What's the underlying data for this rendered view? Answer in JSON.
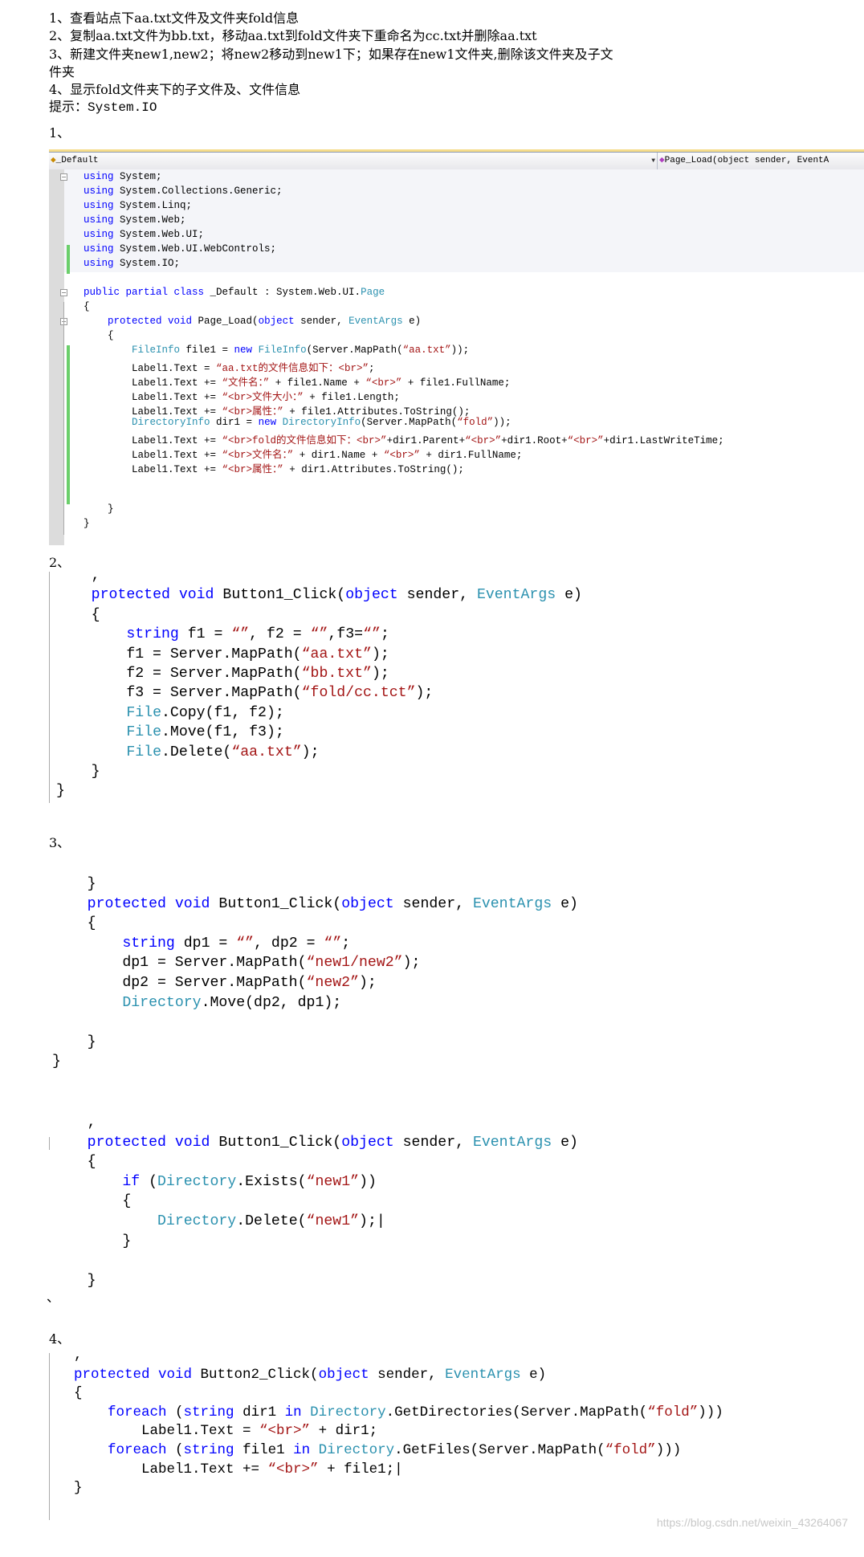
{
  "intro": [
    "1、查看站点下aa.txt文件及文件夹fold信息",
    "2、复制aa.txt文件为bb.txt，移动aa.txt到fold文件夹下重命名为cc.txt并删除aa.txt",
    "3、新建文件夹new1,new2；将new2移动到new1下；如果存在new1文件夹,删除该文件夹及子文",
    "件夹",
    "4、显示fold文件夹下的子文件及、文件信息",
    "提示：System.IO"
  ],
  "section_labels": [
    "1、",
    "2、",
    "3、",
    "、",
    "4、"
  ],
  "editor": {
    "class_dropdown": "_Default",
    "method_dropdown": "Page_Load(object sender, EventA",
    "class_icon": "class-icon",
    "method_icon": "method-icon"
  },
  "colors": {
    "keyword": "#0000ff",
    "type": "#2b91af",
    "string": "#a31515",
    "change_bar": "#6bcf6b"
  },
  "code": {
    "s1": [
      [
        [
          "using",
          "k"
        ],
        [
          " System;",
          "n"
        ]
      ],
      [
        [
          "using",
          "k"
        ],
        [
          " System.Collections.Generic;",
          "n"
        ]
      ],
      [
        [
          "using",
          "k"
        ],
        [
          " System.Linq;",
          "n"
        ]
      ],
      [
        [
          "using",
          "k"
        ],
        [
          " System.Web;",
          "n"
        ]
      ],
      [
        [
          "using",
          "k"
        ],
        [
          " System.Web.UI;",
          "n"
        ]
      ],
      [
        [
          "using",
          "k"
        ],
        [
          " System.Web.UI.WebControls;",
          "n"
        ]
      ],
      [
        [
          "using",
          "k"
        ],
        [
          " System.IO;",
          "n"
        ]
      ],
      [],
      [
        [
          "public partial class",
          "k"
        ],
        [
          " _Default : System.Web.UI.",
          "n"
        ],
        [
          "Page",
          "t"
        ]
      ],
      [
        [
          "{",
          "n"
        ]
      ],
      [
        [
          "    ",
          "n"
        ],
        [
          "protected void",
          "k"
        ],
        [
          " Page_Load(",
          "n"
        ],
        [
          "object",
          "k"
        ],
        [
          " sender, ",
          "n"
        ],
        [
          "EventArgs",
          "t"
        ],
        [
          " e)",
          "n"
        ]
      ],
      [
        [
          "    {",
          "n"
        ]
      ],
      [
        [
          "        ",
          "n"
        ],
        [
          "FileInfo",
          "t"
        ],
        [
          " file1 = ",
          "n"
        ],
        [
          "new",
          "k"
        ],
        [
          " ",
          "n"
        ],
        [
          "FileInfo",
          "t"
        ],
        [
          "(Server.MapPath(",
          "n"
        ],
        [
          "“aa.txt”",
          "s"
        ],
        [
          "));",
          "n"
        ]
      ],
      [
        [
          "        Label1.Text = ",
          "n"
        ],
        [
          "“aa.txt的文件信息如下：<br>”",
          "s"
        ],
        [
          ";",
          "n"
        ]
      ],
      [
        [
          "        Label1.Text += ",
          "n"
        ],
        [
          "“文件名：”",
          "s"
        ],
        [
          " + file1.Name + ",
          "n"
        ],
        [
          "“<br>”",
          "s"
        ],
        [
          " + file1.FullName;",
          "n"
        ]
      ],
      [
        [
          "        Label1.Text += ",
          "n"
        ],
        [
          "“<br>文件大小：”",
          "s"
        ],
        [
          " + file1.Length;",
          "n"
        ]
      ],
      [
        [
          "        Label1.Text += ",
          "n"
        ],
        [
          "“<br>属性：”",
          "s"
        ],
        [
          " + file1.Attributes.ToString();",
          "n"
        ]
      ],
      [
        [
          "        ",
          "n"
        ],
        [
          "DirectoryInfo",
          "t"
        ],
        [
          " dir1 = ",
          "n"
        ],
        [
          "new",
          "k"
        ],
        [
          " ",
          "n"
        ],
        [
          "DirectoryInfo",
          "t"
        ],
        [
          "(Server.MapPath(",
          "n"
        ],
        [
          "“fold”",
          "s"
        ],
        [
          "));",
          "n"
        ]
      ],
      [
        [
          "        Label1.Text += ",
          "n"
        ],
        [
          "“<br>fold的文件信息如下：<br>”",
          "s"
        ],
        [
          "+dir1.Parent+",
          "n"
        ],
        [
          "“<br>”",
          "s"
        ],
        [
          "+dir1.Root+",
          "n"
        ],
        [
          "“<br>”",
          "s"
        ],
        [
          "+dir1.LastWriteTime;",
          "n"
        ]
      ],
      [
        [
          "        Label1.Text += ",
          "n"
        ],
        [
          "“<br>文件名：”",
          "s"
        ],
        [
          " + dir1.Name + ",
          "n"
        ],
        [
          "“<br>”",
          "s"
        ],
        [
          " + dir1.FullName;",
          "n"
        ]
      ],
      [
        [
          "        Label1.Text += ",
          "n"
        ],
        [
          "“<br>属性：”",
          "s"
        ],
        [
          " + dir1.Attributes.ToString();",
          "n"
        ]
      ],
      [],
      [],
      [
        [
          "    }",
          "n"
        ]
      ],
      [
        [
          "}",
          "n"
        ]
      ]
    ],
    "s2": [
      [
        [
          "    ,",
          "n"
        ]
      ],
      [
        [
          "    ",
          "n"
        ],
        [
          "protected void",
          "k"
        ],
        [
          " Button1_Click(",
          "n"
        ],
        [
          "object",
          "k"
        ],
        [
          " sender, ",
          "n"
        ],
        [
          "EventArgs",
          "t"
        ],
        [
          " e)",
          "n"
        ]
      ],
      [
        [
          "    {",
          "n"
        ]
      ],
      [
        [
          "        ",
          "n"
        ],
        [
          "string",
          "k"
        ],
        [
          " f1 = ",
          "n"
        ],
        [
          "“”",
          "s"
        ],
        [
          ", f2 = ",
          "n"
        ],
        [
          "“”",
          "s"
        ],
        [
          ",f3=",
          "n"
        ],
        [
          "“”",
          "s"
        ],
        [
          ";",
          "n"
        ]
      ],
      [
        [
          "        f1 = Server.MapPath(",
          "n"
        ],
        [
          "“aa.txt”",
          "s"
        ],
        [
          ");",
          "n"
        ]
      ],
      [
        [
          "        f2 = Server.MapPath(",
          "n"
        ],
        [
          "“bb.txt”",
          "s"
        ],
        [
          ");",
          "n"
        ]
      ],
      [
        [
          "        f3 = Server.MapPath(",
          "n"
        ],
        [
          "“fold/cc.tct”",
          "s"
        ],
        [
          ");",
          "n"
        ]
      ],
      [
        [
          "        ",
          "n"
        ],
        [
          "File",
          "t"
        ],
        [
          ".Copy(f1, f2);",
          "n"
        ]
      ],
      [
        [
          "        ",
          "n"
        ],
        [
          "File",
          "t"
        ],
        [
          ".Move(f1, f3);",
          "n"
        ]
      ],
      [
        [
          "        ",
          "n"
        ],
        [
          "File",
          "t"
        ],
        [
          ".Delete(",
          "n"
        ],
        [
          "“aa.txt”",
          "s"
        ],
        [
          ");",
          "n"
        ]
      ],
      [
        [
          "    }",
          "n"
        ]
      ],
      [
        [
          "}",
          "n"
        ]
      ]
    ],
    "s3": [
      [
        [
          "    }",
          "n"
        ]
      ],
      [
        [
          "    ",
          "n"
        ],
        [
          "protected void",
          "k"
        ],
        [
          " Button1_Click(",
          "n"
        ],
        [
          "object",
          "k"
        ],
        [
          " sender, ",
          "n"
        ],
        [
          "EventArgs",
          "t"
        ],
        [
          " e)",
          "n"
        ]
      ],
      [
        [
          "    {",
          "n"
        ]
      ],
      [
        [
          "        ",
          "n"
        ],
        [
          "string",
          "k"
        ],
        [
          " dp1 = ",
          "n"
        ],
        [
          "“”",
          "s"
        ],
        [
          ", dp2 = ",
          "n"
        ],
        [
          "“”",
          "s"
        ],
        [
          ";",
          "n"
        ]
      ],
      [
        [
          "        dp1 = Server.MapPath(",
          "n"
        ],
        [
          "“new1/new2”",
          "s"
        ],
        [
          ");",
          "n"
        ]
      ],
      [
        [
          "        dp2 = Server.MapPath(",
          "n"
        ],
        [
          "“new2”",
          "s"
        ],
        [
          ");",
          "n"
        ]
      ],
      [
        [
          "        ",
          "n"
        ],
        [
          "Directory",
          "t"
        ],
        [
          ".Move(dp2, dp1);",
          "n"
        ]
      ],
      [],
      [
        [
          "    }",
          "n"
        ]
      ],
      [
        [
          "}",
          "n"
        ]
      ]
    ],
    "s3b": [
      [
        [
          "    ,",
          "n"
        ]
      ],
      [
        [
          "    ",
          "n"
        ],
        [
          "protected void",
          "k"
        ],
        [
          " Button1_Click(",
          "n"
        ],
        [
          "object",
          "k"
        ],
        [
          " sender, ",
          "n"
        ],
        [
          "EventArgs",
          "t"
        ],
        [
          " e)",
          "n"
        ]
      ],
      [
        [
          "    {",
          "n"
        ]
      ],
      [
        [
          "        ",
          "n"
        ],
        [
          "if",
          "k"
        ],
        [
          " (",
          "n"
        ],
        [
          "Directory",
          "t"
        ],
        [
          ".Exists(",
          "n"
        ],
        [
          "“new1”",
          "s"
        ],
        [
          "))",
          "n"
        ]
      ],
      [
        [
          "        {",
          "n"
        ]
      ],
      [
        [
          "            ",
          "n"
        ],
        [
          "Directory",
          "t"
        ],
        [
          ".Delete(",
          "n"
        ],
        [
          "“new1”",
          "s"
        ],
        [
          ");|",
          "n"
        ]
      ],
      [
        [
          "        }",
          "n"
        ]
      ],
      [],
      [
        [
          "    }",
          "n"
        ]
      ]
    ],
    "s4": [
      [
        [
          ",",
          "n"
        ]
      ],
      [
        [
          "protected void",
          "k"
        ],
        [
          " Button2_Click(",
          "n"
        ],
        [
          "object",
          "k"
        ],
        [
          " sender, ",
          "n"
        ],
        [
          "EventArgs",
          "t"
        ],
        [
          " e)",
          "n"
        ]
      ],
      [
        [
          "{",
          "n"
        ]
      ],
      [
        [
          "    ",
          "n"
        ],
        [
          "foreach",
          "k"
        ],
        [
          " (",
          "n"
        ],
        [
          "string",
          "k"
        ],
        [
          " dir1 ",
          "n"
        ],
        [
          "in",
          "k"
        ],
        [
          " ",
          "n"
        ],
        [
          "Directory",
          "t"
        ],
        [
          ".GetDirectories(Server.MapPath(",
          "n"
        ],
        [
          "“fold”",
          "s"
        ],
        [
          ")))",
          "n"
        ]
      ],
      [
        [
          "        Label1.Text = ",
          "n"
        ],
        [
          "“<br>”",
          "s"
        ],
        [
          " + dir1;",
          "n"
        ]
      ],
      [
        [
          "    ",
          "n"
        ],
        [
          "foreach",
          "k"
        ],
        [
          " (",
          "n"
        ],
        [
          "string",
          "k"
        ],
        [
          " file1 ",
          "n"
        ],
        [
          "in",
          "k"
        ],
        [
          " ",
          "n"
        ],
        [
          "Directory",
          "t"
        ],
        [
          ".GetFiles(Server.MapPath(",
          "n"
        ],
        [
          "“fold”",
          "s"
        ],
        [
          ")))",
          "n"
        ]
      ],
      [
        [
          "        Label1.Text += ",
          "n"
        ],
        [
          "“<br>”",
          "s"
        ],
        [
          " + file1;|",
          "n"
        ]
      ],
      [
        [
          "}",
          "n"
        ]
      ]
    ]
  },
  "watermark": "https://blog.csdn.net/weixin_43264067"
}
